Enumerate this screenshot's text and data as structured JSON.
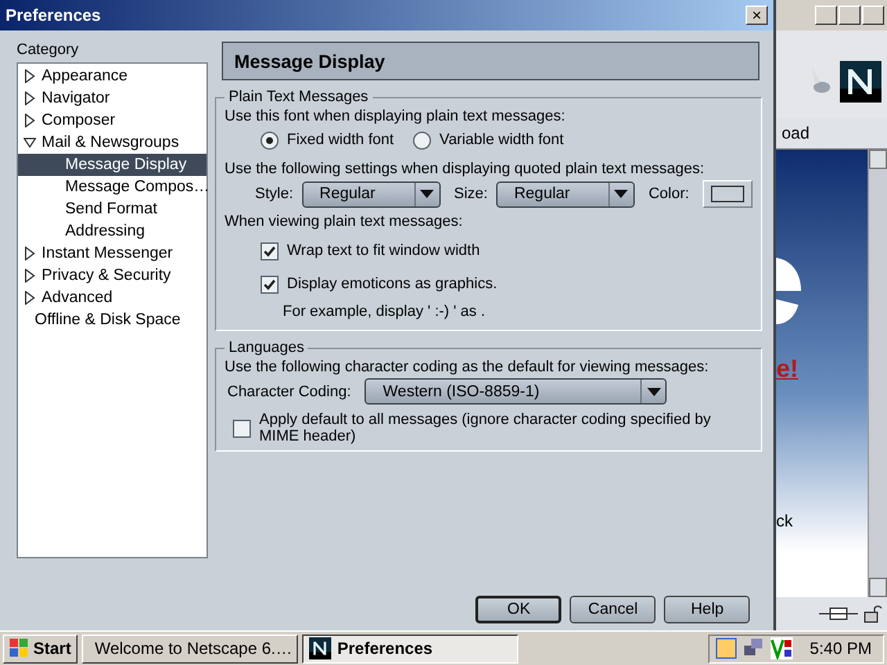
{
  "dialog": {
    "title": "Preferences",
    "close": "×"
  },
  "category": {
    "label": "Category",
    "items": [
      {
        "label": "Appearance",
        "expanded": false,
        "selected": false
      },
      {
        "label": "Navigator",
        "expanded": false,
        "selected": false
      },
      {
        "label": "Composer",
        "expanded": false,
        "selected": false
      },
      {
        "label": "Mail & Newsgroups",
        "expanded": true,
        "selected": false,
        "children": [
          {
            "label": "Message Display",
            "selected": true
          },
          {
            "label": "Message Compos…",
            "selected": false
          },
          {
            "label": "Send Format",
            "selected": false
          },
          {
            "label": "Addressing",
            "selected": false
          }
        ]
      },
      {
        "label": "Instant Messenger",
        "expanded": false,
        "selected": false
      },
      {
        "label": "Privacy & Security",
        "expanded": false,
        "selected": false
      },
      {
        "label": "Advanced",
        "expanded": false,
        "selected": false
      },
      {
        "label": "Offline & Disk Space",
        "selected": false
      }
    ]
  },
  "panel": {
    "heading": "Message Display",
    "plain_text": {
      "legend": "Plain Text Messages",
      "font_prompt": "Use this font when displaying plain text messages:",
      "font_options": [
        {
          "label": "Fixed width font",
          "selected": true
        },
        {
          "label": "Variable width font",
          "selected": false
        }
      ],
      "quoted_prompt": "Use the following settings when displaying quoted plain text messages:",
      "style": {
        "label": "Style:",
        "value": "Regular"
      },
      "size": {
        "label": "Size:",
        "value": "Regular"
      },
      "color": {
        "label": "Color:"
      },
      "viewing_prompt": "When viewing plain text messages:",
      "options": [
        {
          "label": "Wrap text to fit window width",
          "checked": true
        },
        {
          "label": "Display emoticons as graphics.",
          "checked": true
        }
      ],
      "example": "For example, display ' :-) ' as ."
    },
    "languages": {
      "legend": "Languages",
      "prompt": "Use the following character coding as the default for viewing messages:",
      "coding": {
        "label": "Character Coding:",
        "value": "Western (ISO-8859-1)"
      },
      "apply": {
        "label": "Apply default to all messages (ignore character coding specified by MIME header)",
        "checked": false
      }
    }
  },
  "buttons": [
    {
      "label": "OK",
      "default": true
    },
    {
      "label": "Cancel",
      "default": false
    },
    {
      "label": "Help",
      "default": false
    }
  ],
  "background_window": {
    "toolbar_text": "oad",
    "headline": "e!",
    "body_text": "ck"
  },
  "taskbar": {
    "start": "Start",
    "tasks": [
      {
        "label": "Welcome to Netscape 6.…",
        "selected": false
      },
      {
        "label": "Preferences",
        "selected": true
      }
    ],
    "clock": "5:40 PM"
  }
}
